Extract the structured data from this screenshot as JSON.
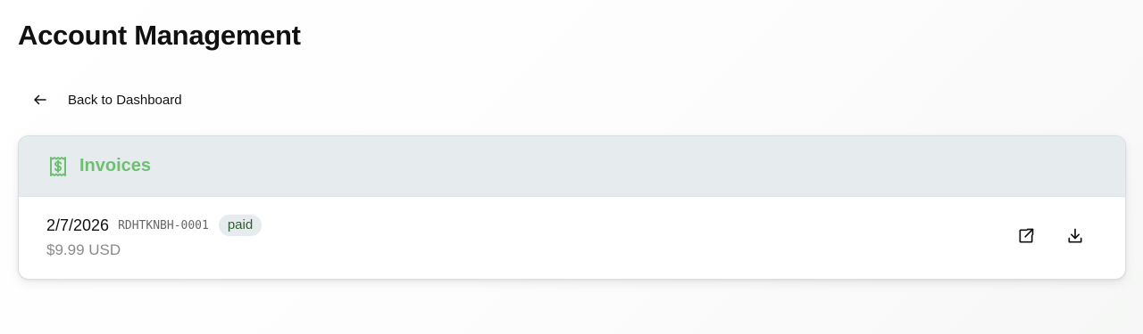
{
  "page": {
    "title": "Account Management"
  },
  "back_link": {
    "label": "Back to Dashboard",
    "icon": "arrow-left-icon"
  },
  "invoices_card": {
    "title": "Invoices",
    "icon": "receipt-dollar-icon",
    "accent_color": "#6fbf73",
    "items": [
      {
        "date": "2/7/2026",
        "number": "RDHTKNBH-0001",
        "status": "paid",
        "amount": "$9.99 USD",
        "actions": [
          "external-link-icon",
          "download-icon"
        ]
      }
    ]
  }
}
